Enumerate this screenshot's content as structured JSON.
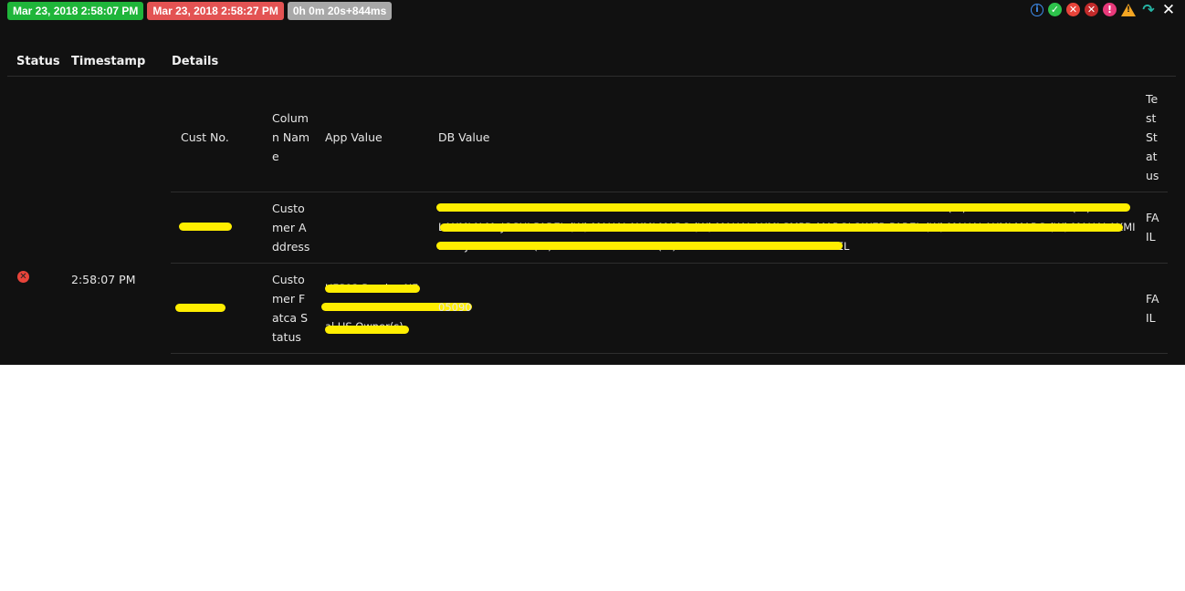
{
  "times": {
    "start": "Mar 23, 2018 2:58:07 PM",
    "end": "Mar 23, 2018 2:58:27 PM",
    "duration": "0h 0m 20s+844ms"
  },
  "toolbar": {
    "info": "i",
    "pass": "✓",
    "fail": "✕",
    "fatal": "✕",
    "error": "!",
    "warning": "!",
    "skip": "↷",
    "close": "✕"
  },
  "columns": {
    "status": "Status",
    "timestamp": "Timestamp",
    "details": "Details"
  },
  "log": {
    "status_icon": "✕",
    "timestamp": "2:58:07 PM"
  },
  "inner": {
    "headers": {
      "cust_no": "Cust No.",
      "column_name_lines": [
        "Colum",
        "n Nam",
        "e"
      ],
      "app_value": "App Value",
      "db_value": "DB Value",
      "test_status_lines": [
        "Te",
        "st",
        "St",
        "at",
        "us"
      ]
    },
    "rows": [
      {
        "column_name_lines": [
          "Custo",
          "mer A",
          "ddress"
        ],
        "db_value_lines": [
          "203 THE EMPIRE BUSINESS CENTRE EMPIRE COMPLEX 414 SENAPATI BAPAT MARGLOWER PAREL (W) MAHALAXMI MARG (W) MAHA",
          "LAXMI N.M. JOSHI PAREL (W) MAHALAXMI MARG (W) MAHALAXMI SMPD MARGLOWER PAREL (W) MAHALAXMI MARG (W) MAHALAXMI",
          "N.M. JOSHI PAREL (W) MAHALAXMI MARG (W) MAHALAXMI MILLS BAPAT PAREL"
        ],
        "test_status_lines": [
          "FA",
          "IL"
        ]
      },
      {
        "column_name_lines": [
          "Custo",
          "mer F",
          "atca S",
          "tatus"
        ],
        "app_value_lines": [
          "UFS03 Passive NF",
          "FE with Substanti",
          "al US Owner(s)"
        ],
        "db_value_lines": [
          "05090"
        ],
        "test_status_lines": [
          "FA",
          "IL"
        ]
      }
    ]
  }
}
